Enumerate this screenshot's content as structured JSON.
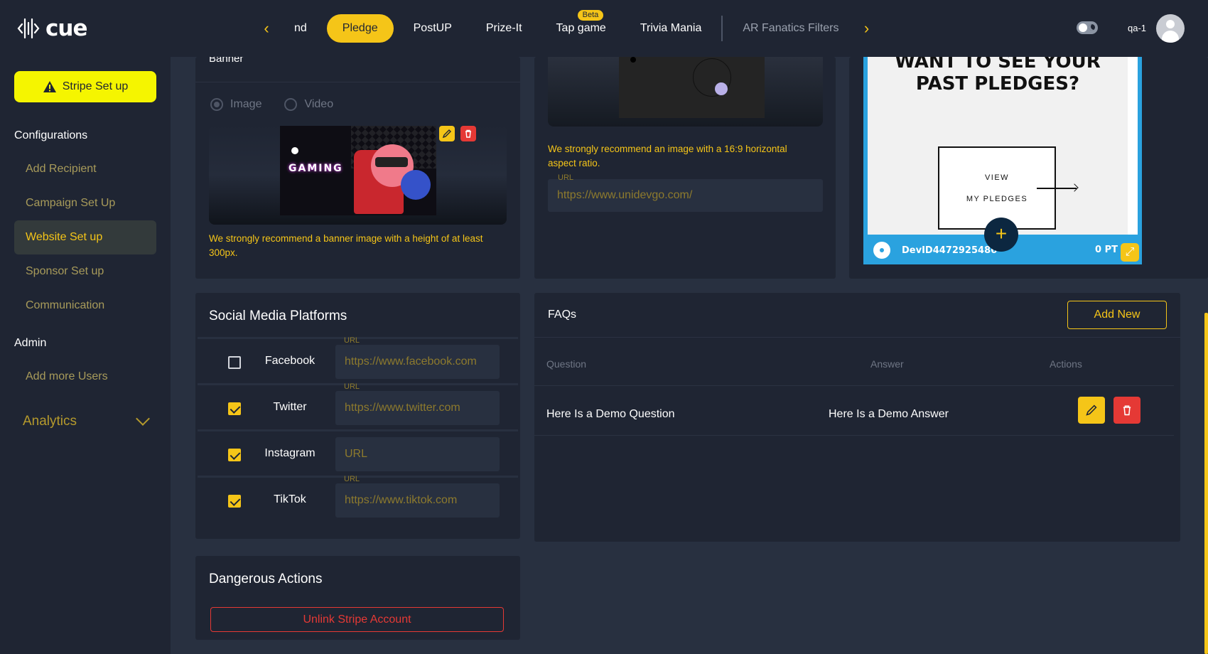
{
  "app": {
    "logo_text": "cue"
  },
  "topnav": {
    "tabs": [
      {
        "label": "nd"
      },
      {
        "label": "Pledge",
        "active": true
      },
      {
        "label": "PostUP"
      },
      {
        "label": "Prize-It"
      },
      {
        "label": "Tap game",
        "badge": "Beta"
      },
      {
        "label": "Trivia Mania"
      },
      {
        "label": "AR Fanatics Filters"
      }
    ],
    "prev_icon": "chevron-left-icon",
    "next_icon": "chevron-right-icon"
  },
  "user": {
    "name": "qa-1"
  },
  "sidebar": {
    "stripe_button": "Stripe Set up",
    "sections": [
      {
        "title": "Configurations",
        "items": [
          "Add Recipient",
          "Campaign Set Up",
          "Website Set up",
          "Sponsor Set up",
          "Communication"
        ]
      },
      {
        "title": "Admin",
        "items": [
          "Add more Users"
        ]
      }
    ],
    "active_item": "Website Set up",
    "analytics": "Analytics"
  },
  "banner": {
    "title": "Banner",
    "options": [
      "Image",
      "Video"
    ],
    "selected": "Image",
    "image_text": "GAMING",
    "hint": "We strongly recommend a banner image with a height of at least 300px."
  },
  "logo_section": {
    "hint": "We strongly recommend an image with a 16:9 horizontal aspect ratio.",
    "url_label": "URL",
    "url_value": "https://www.unidevgo.com/"
  },
  "preview": {
    "heading": "WANT TO SEE YOUR PAST PLEDGES?",
    "view_line1": "VIEW",
    "view_line2": "MY PLEDGES",
    "device_id": "DevID4472925486",
    "points": "0 PT"
  },
  "social": {
    "title": "Social Media Platforms",
    "platforms": [
      {
        "name": "Facebook",
        "checked": false,
        "label": "URL",
        "value": "https://www.facebook.com"
      },
      {
        "name": "Twitter",
        "checked": true,
        "label": "URL",
        "value": "https://www.twitter.com"
      },
      {
        "name": "Instagram",
        "checked": true,
        "label": "",
        "value": "URL"
      },
      {
        "name": "TikTok",
        "checked": true,
        "label": "URL",
        "value": "https://www.tiktok.com"
      }
    ]
  },
  "danger": {
    "title": "Dangerous Actions",
    "unlink_button": "Unlink Stripe Account"
  },
  "faqs": {
    "title": "FAQs",
    "add_button": "Add New",
    "columns": [
      "Question",
      "Answer",
      "Actions"
    ],
    "rows": [
      {
        "question": "Here Is a Demo Question",
        "answer": "Here Is a Demo Answer"
      }
    ]
  },
  "colors": {
    "accent": "#f5c518",
    "danger": "#e53935",
    "stripe": "#f5f500",
    "bg": "#1f2533",
    "panel": "#283040"
  }
}
